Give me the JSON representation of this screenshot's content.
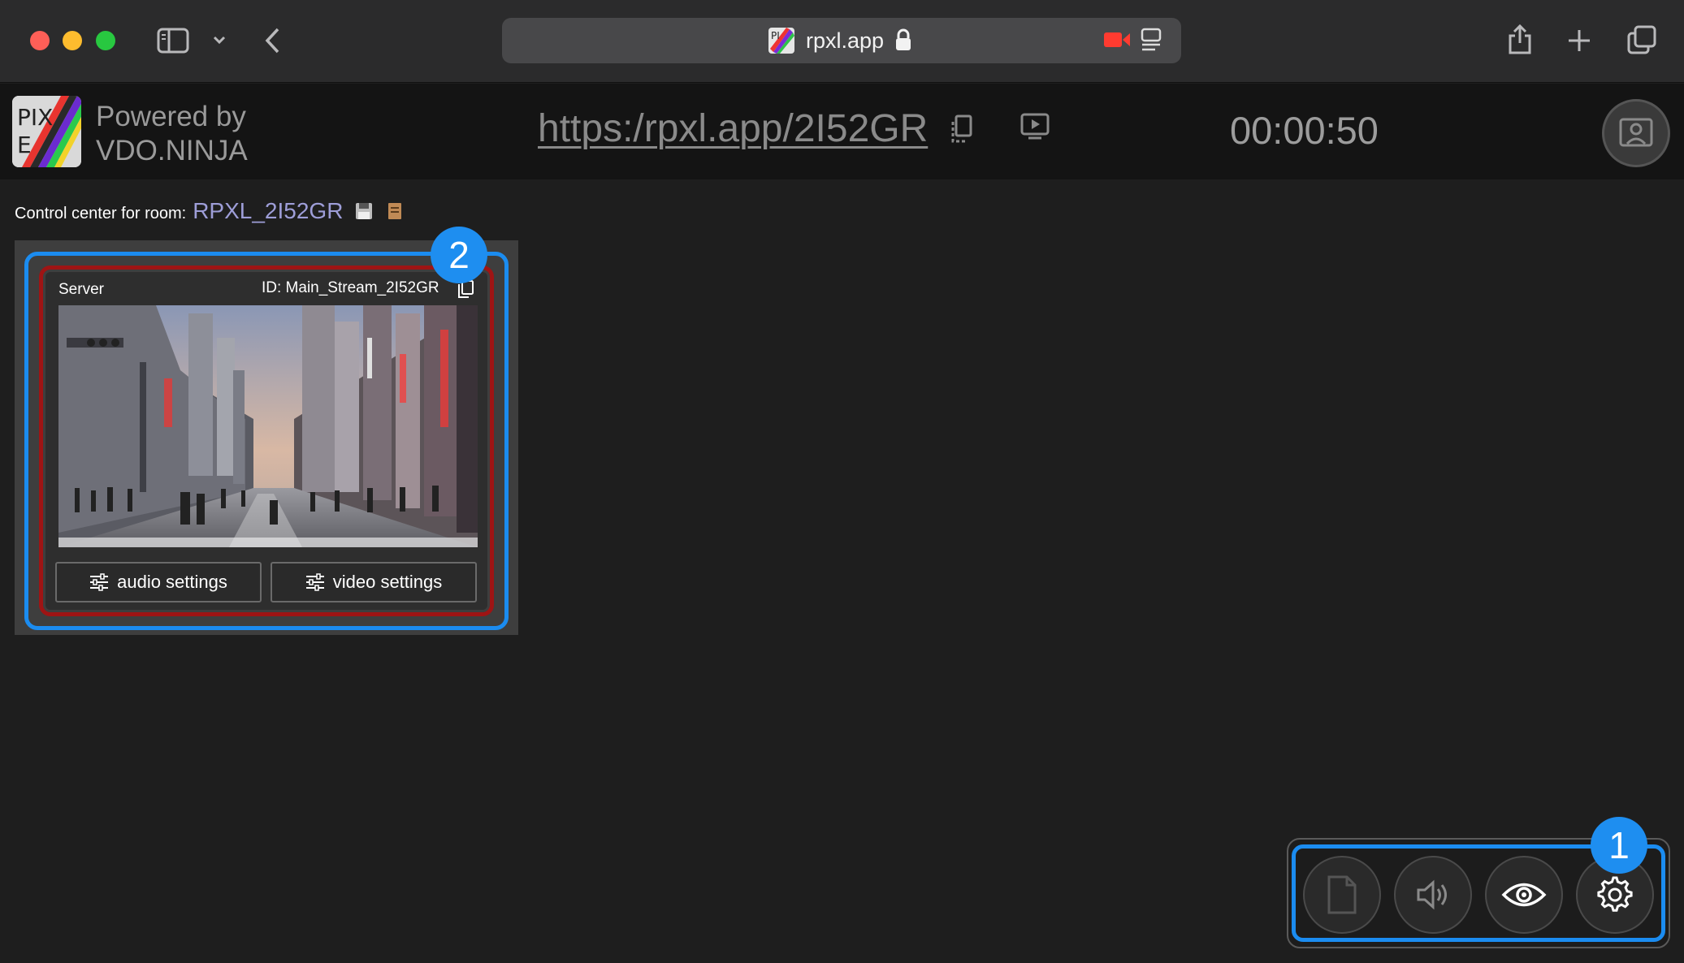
{
  "browser": {
    "address": "rpxl.app",
    "icons": [
      "sidebar-icon",
      "chevron-down-icon",
      "back-icon",
      "lock-icon",
      "camera-recording-icon",
      "reader-icon",
      "share-icon",
      "new-tab-icon",
      "tabs-overview-icon"
    ]
  },
  "header": {
    "logo_text": "PIXELS",
    "powered_line1": "Powered by",
    "powered_line2": "VDO.NINJA",
    "share_url": "https:/rpxl.app/2I52GR",
    "timer": "00:00:50"
  },
  "room": {
    "label": "Control center for room:",
    "name": "RPXL_2I52GR"
  },
  "guest": {
    "label": "Server",
    "stream_id": "ID: Main_Stream_2I52GR",
    "audio_settings": "audio settings",
    "video_settings": "video settings"
  },
  "annotations": {
    "badge_1": "1",
    "badge_2": "2",
    "highlight_color": "#1b8cf0",
    "inner_highlight_color": "#9e1414"
  },
  "toolbar": {
    "buttons": [
      "document-icon",
      "speaker-icon",
      "eye-icon",
      "gear-icon"
    ]
  }
}
